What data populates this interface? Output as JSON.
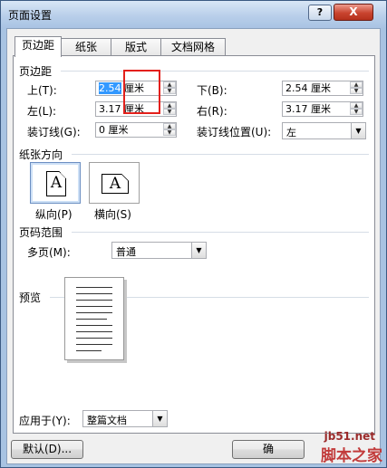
{
  "window": {
    "title": "页面设置",
    "help_label": "?",
    "close_label": "X"
  },
  "tabs": [
    {
      "label": "页边距"
    },
    {
      "label": "纸张"
    },
    {
      "label": "版式"
    },
    {
      "label": "文档网格"
    }
  ],
  "margins": {
    "group_title": "页边距",
    "top_label": "上(T):",
    "top_value": "2.54",
    "top_unit": "厘米",
    "bottom_label": "下(B):",
    "bottom_value": "2.54 厘米",
    "left_label": "左(L):",
    "left_value": "3.17",
    "left_unit": "厘米",
    "right_label": "右(R):",
    "right_value": "3.17 厘米",
    "gutter_label": "装订线(G):",
    "gutter_value": "0 厘米",
    "gutter_pos_label": "装订线位置(U):",
    "gutter_pos_value": "左"
  },
  "orientation": {
    "group_title": "纸张方向",
    "portrait_label": "纵向(P)",
    "landscape_label": "横向(S)",
    "icon_letter": "A"
  },
  "pages": {
    "group_title": "页码范围",
    "multiple_label": "多页(M):",
    "multiple_value": "普通"
  },
  "preview": {
    "group_title": "预览"
  },
  "apply": {
    "label": "应用于(Y):",
    "value": "整篇文档"
  },
  "buttons": {
    "default_label": "默认(D)...",
    "ok_label": "确"
  },
  "watermark": {
    "site": "jb51.net",
    "brand": "脚本之家"
  }
}
